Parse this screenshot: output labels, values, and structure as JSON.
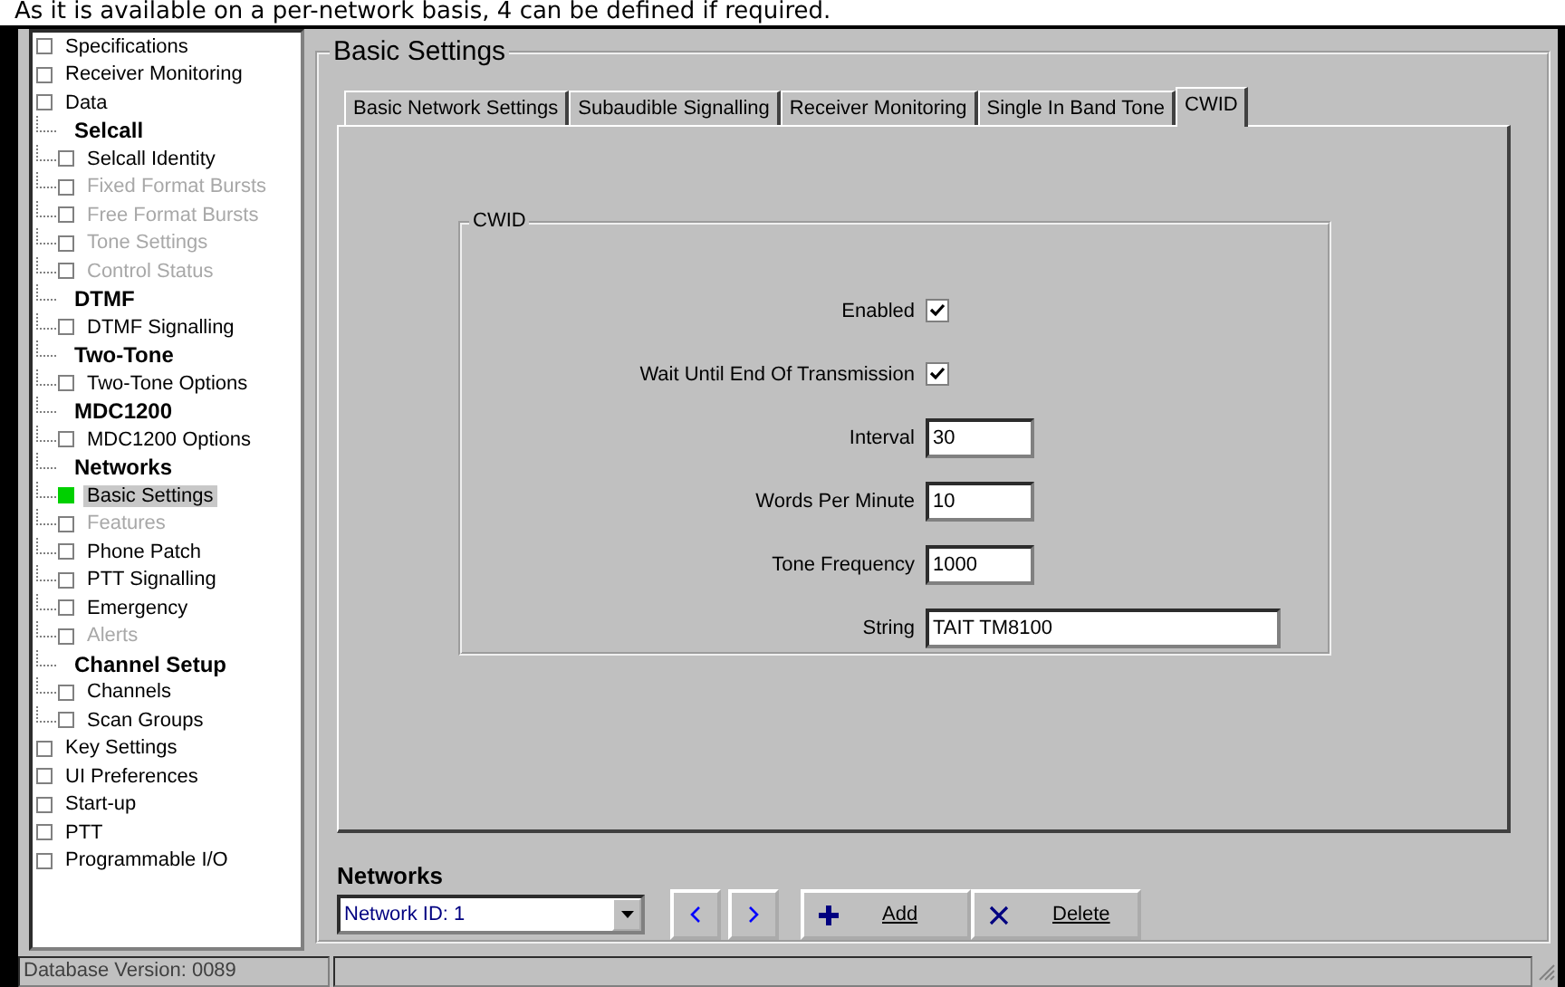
{
  "caption": "As it is available on a per-network basis, 4 can be defined if required.",
  "tree": [
    {
      "kind": "page",
      "label": "Specifications",
      "disabled": false,
      "selected": false
    },
    {
      "kind": "page",
      "label": "Receiver Monitoring",
      "disabled": false,
      "selected": false
    },
    {
      "kind": "page",
      "label": "Data",
      "disabled": false,
      "selected": false
    },
    {
      "kind": "group",
      "label": "Selcall",
      "children": [
        {
          "kind": "page",
          "label": "Selcall Identity",
          "disabled": false,
          "selected": false
        },
        {
          "kind": "page",
          "label": "Fixed Format Bursts",
          "disabled": true,
          "selected": false
        },
        {
          "kind": "page",
          "label": "Free Format Bursts",
          "disabled": true,
          "selected": false
        },
        {
          "kind": "page",
          "label": "Tone Settings",
          "disabled": true,
          "selected": false
        },
        {
          "kind": "page",
          "label": "Control Status",
          "disabled": true,
          "selected": false
        }
      ]
    },
    {
      "kind": "group",
      "label": "DTMF",
      "children": [
        {
          "kind": "page",
          "label": "DTMF Signalling",
          "disabled": false,
          "selected": false
        }
      ]
    },
    {
      "kind": "group",
      "label": "Two-Tone",
      "children": [
        {
          "kind": "page",
          "label": "Two-Tone Options",
          "disabled": false,
          "selected": false
        }
      ]
    },
    {
      "kind": "group",
      "label": "MDC1200",
      "children": [
        {
          "kind": "page",
          "label": "MDC1200 Options",
          "disabled": false,
          "selected": false
        }
      ]
    },
    {
      "kind": "group",
      "label": "Networks",
      "children": [
        {
          "kind": "page",
          "label": "Basic Settings",
          "disabled": false,
          "selected": true
        },
        {
          "kind": "page",
          "label": "Features",
          "disabled": true,
          "selected": false
        },
        {
          "kind": "page",
          "label": "Phone Patch",
          "disabled": false,
          "selected": false
        },
        {
          "kind": "page",
          "label": "PTT Signalling",
          "disabled": false,
          "selected": false
        },
        {
          "kind": "page",
          "label": "Emergency",
          "disabled": false,
          "selected": false
        },
        {
          "kind": "page",
          "label": "Alerts",
          "disabled": true,
          "selected": false
        }
      ]
    },
    {
      "kind": "group",
      "label": "Channel Setup",
      "children": [
        {
          "kind": "page",
          "label": "Channels",
          "disabled": false,
          "selected": false
        },
        {
          "kind": "page",
          "label": "Scan Groups",
          "disabled": false,
          "selected": false
        }
      ]
    },
    {
      "kind": "page",
      "label": "Key Settings",
      "disabled": false,
      "selected": false
    },
    {
      "kind": "page",
      "label": "UI Preferences",
      "disabled": false,
      "selected": false
    },
    {
      "kind": "page",
      "label": "Start-up",
      "disabled": false,
      "selected": false
    },
    {
      "kind": "page",
      "label": "PTT",
      "disabled": false,
      "selected": false
    },
    {
      "kind": "page",
      "label": "Programmable I/O",
      "disabled": false,
      "selected": false
    }
  ],
  "status_bar": "Database Version: 0089",
  "panel_title": "Basic Settings",
  "tabs": [
    {
      "label": "Basic Network Settings",
      "selected": false
    },
    {
      "label": "Subaudible Signalling",
      "selected": false
    },
    {
      "label": "Receiver Monitoring",
      "selected": false
    },
    {
      "label": "Single In Band Tone",
      "selected": false
    },
    {
      "label": "CWID",
      "selected": true
    }
  ],
  "cwid": {
    "title": "CWID",
    "fields": [
      {
        "kind": "checkbox",
        "label": "Enabled",
        "checked": true
      },
      {
        "kind": "checkbox",
        "label": "Wait Until End Of Transmission",
        "checked": true
      },
      {
        "kind": "text",
        "label": "Interval",
        "value": "30"
      },
      {
        "kind": "text",
        "label": "Words Per Minute",
        "value": "10"
      },
      {
        "kind": "text",
        "label": "Tone Frequency",
        "value": "1000"
      },
      {
        "kind": "wide_text",
        "label": "String",
        "value": "TAIT TM8100"
      }
    ]
  },
  "networks": {
    "label": "Networks",
    "selector": "Network ID: 1",
    "add": "Add",
    "delete": "Delete"
  }
}
